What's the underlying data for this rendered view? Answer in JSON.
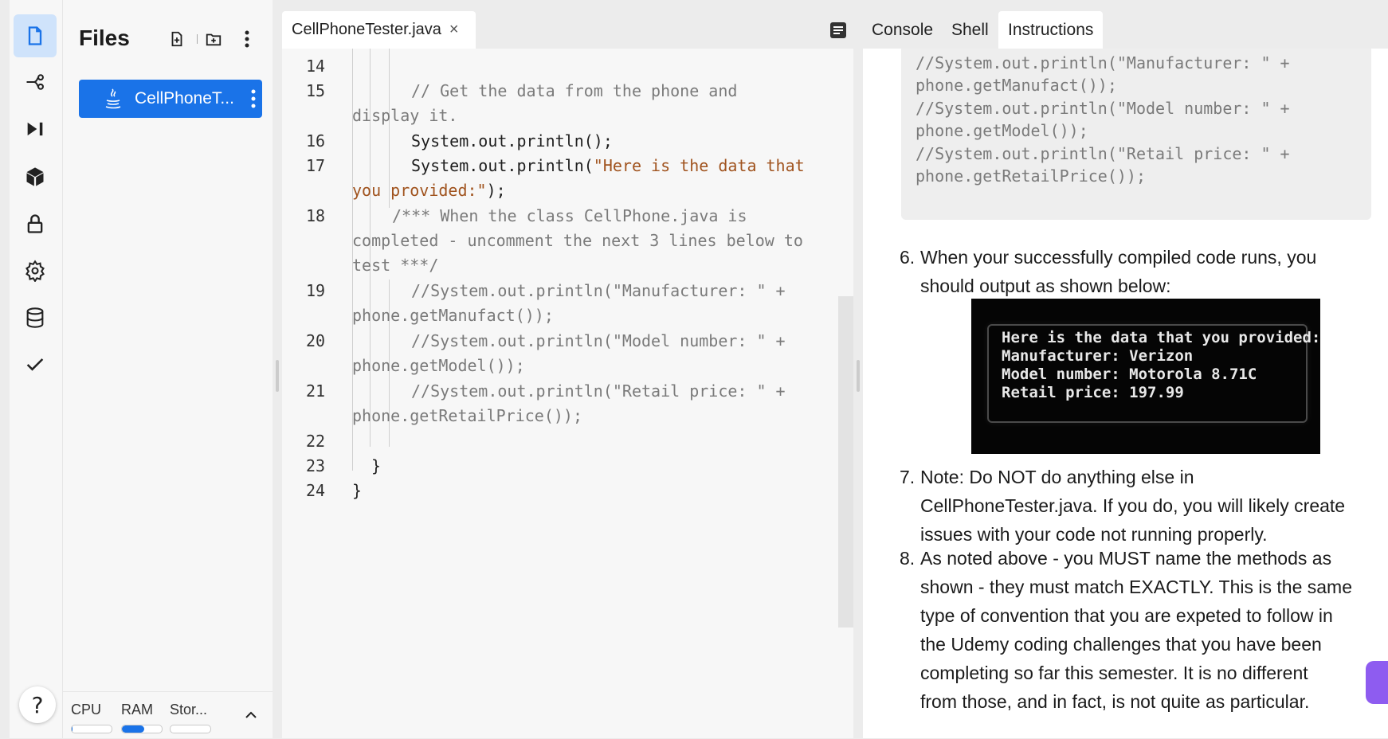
{
  "files_panel": {
    "title": "Files",
    "file_name": "CellPhoneT...",
    "resources": [
      {
        "label": "CPU",
        "level": 0.02
      },
      {
        "label": "RAM",
        "level": 0.55
      },
      {
        "label": "Stor...",
        "level": 0.0
      }
    ]
  },
  "editor": {
    "tab_label": "CellPhoneTester.java",
    "close_glyph": "×",
    "line_numbers": [
      "14",
      "15",
      "16",
      "17",
      "18",
      "19",
      "20",
      "21",
      "22",
      "23",
      "24"
    ],
    "lines": {
      "l15a": "// Get the data from the phone and",
      "l15b": "display it.",
      "l16": "System.out.println();",
      "l17a_code": "System.out.println(",
      "l17a_str": "\"Here is the data that",
      "l17b_str": "you provided:\"",
      "l17b_code": ");",
      "l18a": "/*** When the class CellPhone.java is",
      "l18b": "completed - uncomment the next 3 lines below to",
      "l18c": "test ***/",
      "l19a": "//System.out.println(\"Manufacturer: \" +",
      "l19b": "phone.getManufact());",
      "l20a": "//System.out.println(\"Model number: \" +",
      "l20b": "phone.getModel());",
      "l21a": "//System.out.println(\"Retail price: \" +",
      "l21b": "phone.getRetailPrice());",
      "l23": "}",
      "l24": "}"
    }
  },
  "right_panel": {
    "tabs": [
      "Console",
      "Shell",
      "Instructions"
    ],
    "active_tab": "Instructions",
    "code_box": [
      "//System.out.println(\"Manufacturer: \" +",
      "phone.getManufact());",
      "//System.out.println(\"Model number: \" +",
      "phone.getModel());",
      "//System.out.println(\"Retail price: \" +",
      "phone.getRetailPrice());"
    ],
    "steps": [
      {
        "num": "6.",
        "lines": [
          "When your successfully compiled code runs, you",
          "should output as shown below:"
        ]
      },
      {
        "num": "7.",
        "lines": [
          "Note: Do NOT do anything else in",
          "CellPhoneTester.java. If you do, you will likely create",
          "issues with your code not running properly."
        ]
      },
      {
        "num": "8.",
        "lines": [
          "As noted above - you MUST name the methods as",
          "shown - they must match EXACTLY. This is the same",
          "type of convention that you are expeted to follow in",
          "the Udemy coding challenges that you have been",
          "completing so far this semester. It is no different",
          "from those, and in fact, is not quite as particular."
        ]
      }
    ],
    "terminal_output": [
      "Here is the data that you provided:",
      "Manufacturer: Verizon",
      "Model number: Motorola 8.71C",
      "Retail price: 197.99"
    ]
  },
  "help_glyph": "?"
}
